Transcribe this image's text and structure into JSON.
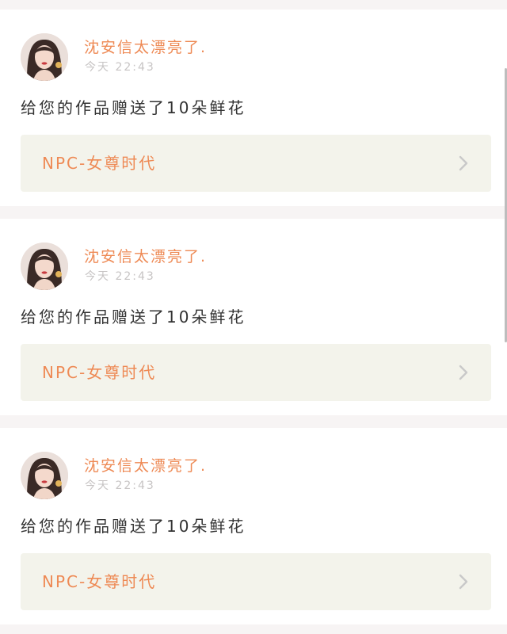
{
  "notifications": [
    {
      "user_name": "沈安信太漂亮了.",
      "time": "今天 22:43",
      "message": "给您的作品赠送了10朵鲜花",
      "work_title": "NPC-女尊时代"
    },
    {
      "user_name": "沈安信太漂亮了.",
      "time": "今天 22:43",
      "message": "给您的作品赠送了10朵鲜花",
      "work_title": "NPC-女尊时代"
    },
    {
      "user_name": "沈安信太漂亮了.",
      "time": "今天 22:43",
      "message": "给您的作品赠送了10朵鲜花",
      "work_title": "NPC-女尊时代"
    }
  ],
  "colors": {
    "accent": "#ee8a55",
    "link_bg": "#f3f3eb",
    "page_bg": "#f7f4f4",
    "muted": "#c7c4c4",
    "text": "#333333"
  },
  "icons": {
    "avatar": "user-avatar",
    "chevron": "chevron-right-icon"
  }
}
